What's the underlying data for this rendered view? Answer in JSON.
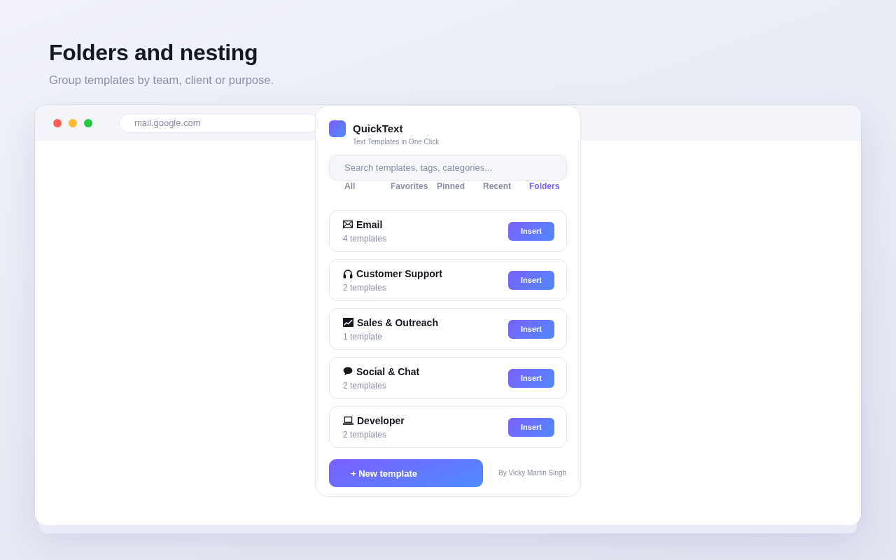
{
  "intro": {
    "title": "Folders and nesting",
    "subtitle": "Group templates by team, client or purpose."
  },
  "browser": {
    "address": "mail.google.com"
  },
  "popup": {
    "app_name": "QuickText",
    "tagline": "Text Templates in One Click",
    "search": {
      "placeholder": "Search templates, tags, categories..."
    },
    "tabs": [
      {
        "label": "All",
        "selected": false
      },
      {
        "label": "Favorites",
        "selected": false
      },
      {
        "label": "Pinned",
        "selected": false
      },
      {
        "label": "Recent",
        "selected": false
      },
      {
        "label": "Folders",
        "selected": true
      }
    ],
    "folders": [
      {
        "name": "Email",
        "count": "4 templates",
        "action": "Insert"
      },
      {
        "name": "Customer Support",
        "count": "2 templates",
        "action": "Insert"
      },
      {
        "name": "Sales & Outreach",
        "count": "1 template",
        "action": "Insert"
      },
      {
        "name": "Social & Chat",
        "count": "2 templates",
        "action": "Insert"
      },
      {
        "name": "Developer",
        "count": "2 templates",
        "action": "Insert"
      }
    ],
    "new_button": "+ New template",
    "credit": "By Vicky Martin Singh"
  }
}
